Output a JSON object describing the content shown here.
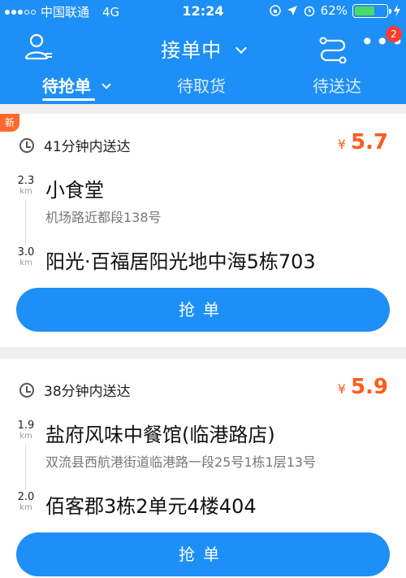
{
  "status_bar": {
    "carrier": "中国联通",
    "network": "4G",
    "time": "12:24",
    "battery": "62%",
    "battery_level": 0.62
  },
  "topbar": {
    "title": "接单中",
    "notification_count": "2"
  },
  "tabs": [
    {
      "label": "待抢单"
    },
    {
      "label": "待取货"
    },
    {
      "label": "待送达"
    }
  ],
  "orders": [
    {
      "new_label": "新",
      "deadline": "41分钟内送达",
      "currency": "¥",
      "price": "5.7",
      "pickup": {
        "distance": "2.3",
        "unit": "km",
        "name": "小食堂",
        "address": "机场路近都段138号"
      },
      "dropoff": {
        "distance": "3.0",
        "unit": "km",
        "name": "阳光·百福居阳光地中海5栋703"
      },
      "button": "抢单"
    },
    {
      "deadline": "38分钟内送达",
      "currency": "¥",
      "price": "5.9",
      "pickup": {
        "distance": "1.9",
        "unit": "km",
        "name": "盐府风味中餐馆(临港路店)",
        "address": "双流县西航港街道临港路一段25号1栋1层13号"
      },
      "dropoff": {
        "distance": "2.0",
        "unit": "km",
        "name": "佰客郡3栋2单元4楼404"
      },
      "button": "抢单"
    }
  ],
  "colors": {
    "primary": "#1d8ff7",
    "price": "#ff5a1f",
    "new_badge": "#ff6a2b",
    "badge": "#ff3b30"
  }
}
